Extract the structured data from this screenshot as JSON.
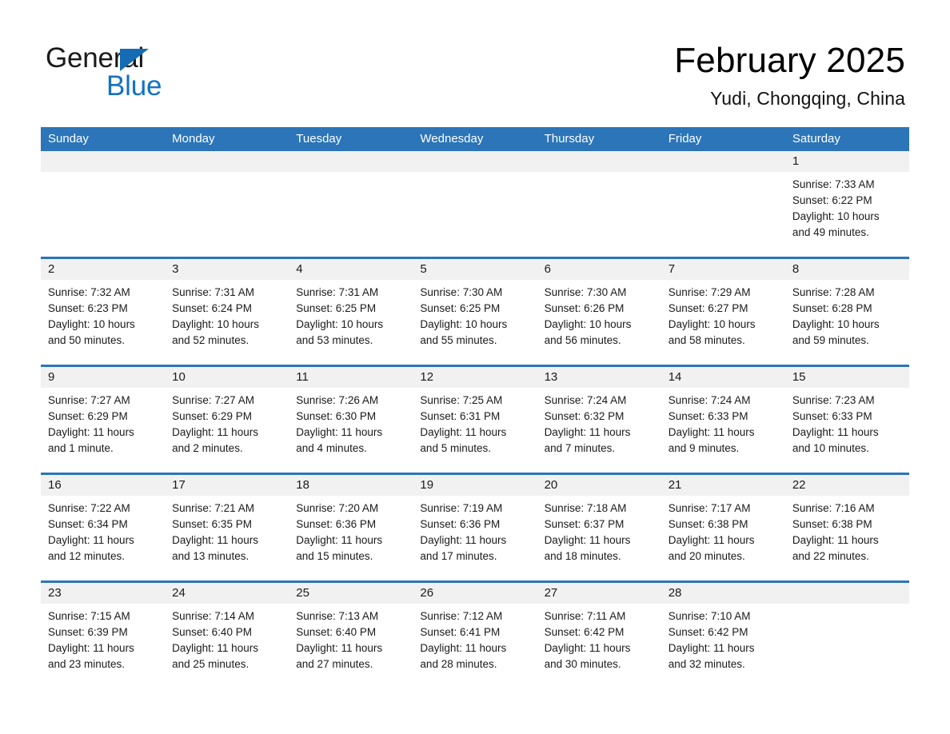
{
  "brand": {
    "name_part1": "General",
    "name_part2": "Blue",
    "triangle_color": "#156cb5",
    "blue_text_color": "#1272c4"
  },
  "header": {
    "month_title": "February 2025",
    "location": "Yudi, Chongqing, China"
  },
  "theme": {
    "header_blue": "#2b75b8",
    "day_band_gray": "#f1f1f1",
    "text_dark": "#1a1a1a",
    "cell_white": "#ffffff"
  },
  "calendar": {
    "weekdays": [
      "Sunday",
      "Monday",
      "Tuesday",
      "Wednesday",
      "Thursday",
      "Friday",
      "Saturday"
    ],
    "weeks": [
      [
        {
          "day": "",
          "lines": []
        },
        {
          "day": "",
          "lines": []
        },
        {
          "day": "",
          "lines": []
        },
        {
          "day": "",
          "lines": []
        },
        {
          "day": "",
          "lines": []
        },
        {
          "day": "",
          "lines": []
        },
        {
          "day": "1",
          "lines": [
            "Sunrise: 7:33 AM",
            "Sunset: 6:22 PM",
            "Daylight: 10 hours",
            "and 49 minutes."
          ]
        }
      ],
      [
        {
          "day": "2",
          "lines": [
            "Sunrise: 7:32 AM",
            "Sunset: 6:23 PM",
            "Daylight: 10 hours",
            "and 50 minutes."
          ]
        },
        {
          "day": "3",
          "lines": [
            "Sunrise: 7:31 AM",
            "Sunset: 6:24 PM",
            "Daylight: 10 hours",
            "and 52 minutes."
          ]
        },
        {
          "day": "4",
          "lines": [
            "Sunrise: 7:31 AM",
            "Sunset: 6:25 PM",
            "Daylight: 10 hours",
            "and 53 minutes."
          ]
        },
        {
          "day": "5",
          "lines": [
            "Sunrise: 7:30 AM",
            "Sunset: 6:25 PM",
            "Daylight: 10 hours",
            "and 55 minutes."
          ]
        },
        {
          "day": "6",
          "lines": [
            "Sunrise: 7:30 AM",
            "Sunset: 6:26 PM",
            "Daylight: 10 hours",
            "and 56 minutes."
          ]
        },
        {
          "day": "7",
          "lines": [
            "Sunrise: 7:29 AM",
            "Sunset: 6:27 PM",
            "Daylight: 10 hours",
            "and 58 minutes."
          ]
        },
        {
          "day": "8",
          "lines": [
            "Sunrise: 7:28 AM",
            "Sunset: 6:28 PM",
            "Daylight: 10 hours",
            "and 59 minutes."
          ]
        }
      ],
      [
        {
          "day": "9",
          "lines": [
            "Sunrise: 7:27 AM",
            "Sunset: 6:29 PM",
            "Daylight: 11 hours",
            "and 1 minute."
          ]
        },
        {
          "day": "10",
          "lines": [
            "Sunrise: 7:27 AM",
            "Sunset: 6:29 PM",
            "Daylight: 11 hours",
            "and 2 minutes."
          ]
        },
        {
          "day": "11",
          "lines": [
            "Sunrise: 7:26 AM",
            "Sunset: 6:30 PM",
            "Daylight: 11 hours",
            "and 4 minutes."
          ]
        },
        {
          "day": "12",
          "lines": [
            "Sunrise: 7:25 AM",
            "Sunset: 6:31 PM",
            "Daylight: 11 hours",
            "and 5 minutes."
          ]
        },
        {
          "day": "13",
          "lines": [
            "Sunrise: 7:24 AM",
            "Sunset: 6:32 PM",
            "Daylight: 11 hours",
            "and 7 minutes."
          ]
        },
        {
          "day": "14",
          "lines": [
            "Sunrise: 7:24 AM",
            "Sunset: 6:33 PM",
            "Daylight: 11 hours",
            "and 9 minutes."
          ]
        },
        {
          "day": "15",
          "lines": [
            "Sunrise: 7:23 AM",
            "Sunset: 6:33 PM",
            "Daylight: 11 hours",
            "and 10 minutes."
          ]
        }
      ],
      [
        {
          "day": "16",
          "lines": [
            "Sunrise: 7:22 AM",
            "Sunset: 6:34 PM",
            "Daylight: 11 hours",
            "and 12 minutes."
          ]
        },
        {
          "day": "17",
          "lines": [
            "Sunrise: 7:21 AM",
            "Sunset: 6:35 PM",
            "Daylight: 11 hours",
            "and 13 minutes."
          ]
        },
        {
          "day": "18",
          "lines": [
            "Sunrise: 7:20 AM",
            "Sunset: 6:36 PM",
            "Daylight: 11 hours",
            "and 15 minutes."
          ]
        },
        {
          "day": "19",
          "lines": [
            "Sunrise: 7:19 AM",
            "Sunset: 6:36 PM",
            "Daylight: 11 hours",
            "and 17 minutes."
          ]
        },
        {
          "day": "20",
          "lines": [
            "Sunrise: 7:18 AM",
            "Sunset: 6:37 PM",
            "Daylight: 11 hours",
            "and 18 minutes."
          ]
        },
        {
          "day": "21",
          "lines": [
            "Sunrise: 7:17 AM",
            "Sunset: 6:38 PM",
            "Daylight: 11 hours",
            "and 20 minutes."
          ]
        },
        {
          "day": "22",
          "lines": [
            "Sunrise: 7:16 AM",
            "Sunset: 6:38 PM",
            "Daylight: 11 hours",
            "and 22 minutes."
          ]
        }
      ],
      [
        {
          "day": "23",
          "lines": [
            "Sunrise: 7:15 AM",
            "Sunset: 6:39 PM",
            "Daylight: 11 hours",
            "and 23 minutes."
          ]
        },
        {
          "day": "24",
          "lines": [
            "Sunrise: 7:14 AM",
            "Sunset: 6:40 PM",
            "Daylight: 11 hours",
            "and 25 minutes."
          ]
        },
        {
          "day": "25",
          "lines": [
            "Sunrise: 7:13 AM",
            "Sunset: 6:40 PM",
            "Daylight: 11 hours",
            "and 27 minutes."
          ]
        },
        {
          "day": "26",
          "lines": [
            "Sunrise: 7:12 AM",
            "Sunset: 6:41 PM",
            "Daylight: 11 hours",
            "and 28 minutes."
          ]
        },
        {
          "day": "27",
          "lines": [
            "Sunrise: 7:11 AM",
            "Sunset: 6:42 PM",
            "Daylight: 11 hours",
            "and 30 minutes."
          ]
        },
        {
          "day": "28",
          "lines": [
            "Sunrise: 7:10 AM",
            "Sunset: 6:42 PM",
            "Daylight: 11 hours",
            "and 32 minutes."
          ]
        },
        {
          "day": "",
          "lines": []
        }
      ]
    ]
  }
}
